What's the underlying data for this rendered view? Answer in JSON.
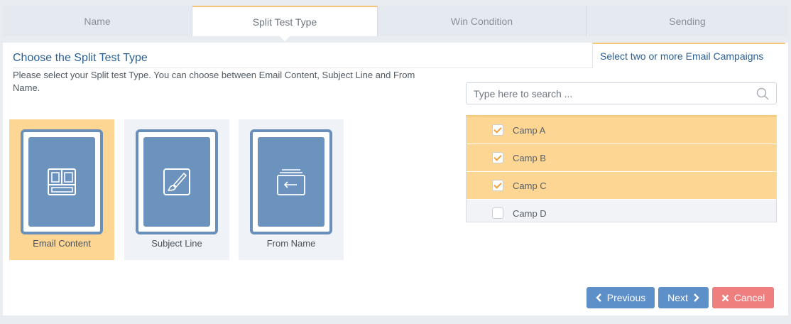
{
  "tabs": [
    {
      "label": "Name"
    },
    {
      "label": "Split Test Type"
    },
    {
      "label": "Win Condition"
    },
    {
      "label": "Sending"
    }
  ],
  "active_tab": "Split Test Type",
  "left_section": {
    "title": "Choose the Split Test Type",
    "description": "Please select your Split test Type. You can choose between Email Content, Subject Line and From Name."
  },
  "types": [
    {
      "label": "Email Content",
      "icon": "layout-icon",
      "selected": true
    },
    {
      "label": "Subject Line",
      "icon": "brush-icon",
      "selected": false
    },
    {
      "label": "From Name",
      "icon": "inbox-icon",
      "selected": false
    }
  ],
  "right_section": {
    "title": "Select two or more Email Campaigns",
    "search_placeholder": "Type here to search ..."
  },
  "campaigns": [
    {
      "label": "Camp A",
      "checked": true
    },
    {
      "label": "Camp B",
      "checked": true
    },
    {
      "label": "Camp C",
      "checked": true
    },
    {
      "label": "Camp D",
      "checked": false
    }
  ],
  "buttons": {
    "previous": "Previous",
    "next": "Next",
    "cancel": "Cancel"
  },
  "colors": {
    "accent": "#fdd694",
    "primary": "#5d8fc9",
    "danger": "#ef7e7e",
    "title": "#2a5f95"
  }
}
